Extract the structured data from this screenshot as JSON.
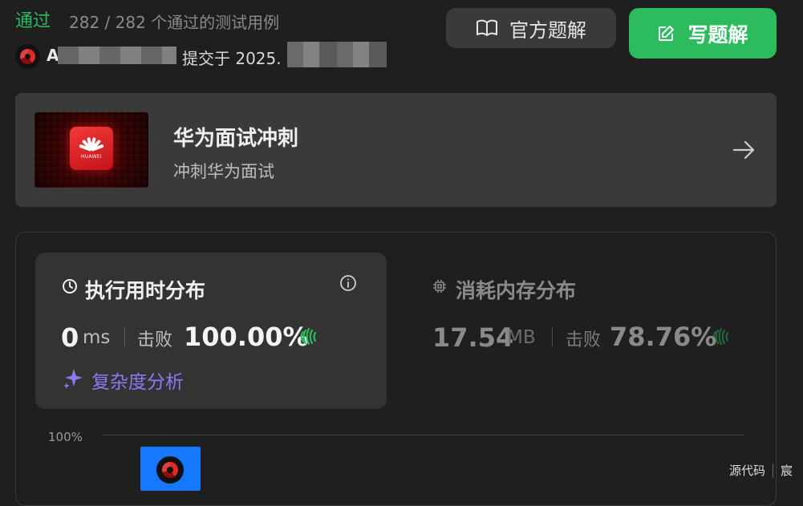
{
  "header": {
    "status": "通过",
    "testcases": "282 / 282 个通过的测试用例",
    "username_initial": "A",
    "submitted_prefix": "提交于 2025."
  },
  "buttons": {
    "official_solution": "官方题解",
    "write_solution": "写题解"
  },
  "banner": {
    "title": "华为面试冲刺",
    "subtitle": "冲刺华为面试",
    "logo_text": "HUAWEI"
  },
  "runtime": {
    "title": "执行用时分布",
    "value": "0",
    "unit": "ms",
    "beats_label": "击败",
    "beats_percent": "100.00%",
    "complexity_link": "复杂度分析"
  },
  "memory": {
    "title": "消耗内存分布",
    "value": "17.54",
    "unit": "MB",
    "beats_label": "击败",
    "beats_percent": "78.76%"
  },
  "chart": {
    "y_axis_top": "100%"
  },
  "footer": {
    "source": "源代码",
    "name": "宸"
  },
  "colors": {
    "accent_green": "#2cbb5d",
    "bar_blue": "#1677ff",
    "link_purple": "#8a7af5"
  }
}
